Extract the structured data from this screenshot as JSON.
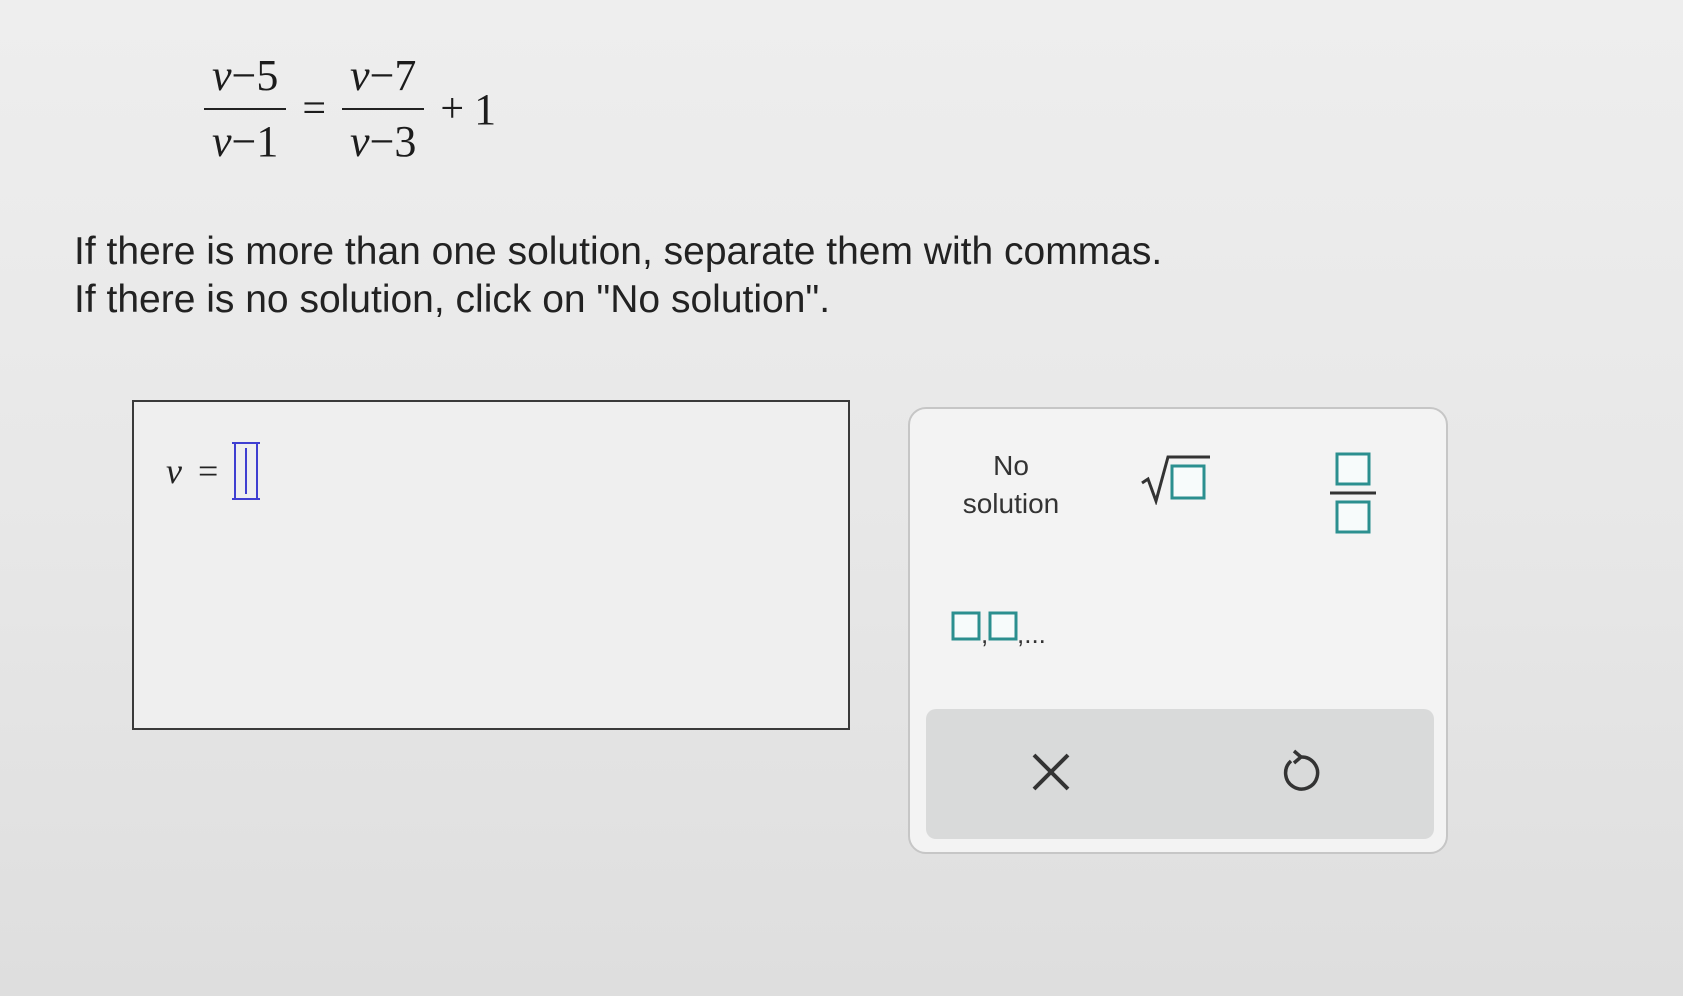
{
  "equation": {
    "left_num_var": "v",
    "left_num_rest": "−5",
    "left_den_var": "v",
    "left_den_rest": "−1",
    "equals": "=",
    "right_num_var": "v",
    "right_num_rest": "−7",
    "right_den_var": "v",
    "right_den_rest": "−3",
    "plus": "+",
    "constant": "1"
  },
  "instructions": {
    "line1": "If there is more than one solution, separate them with commas.",
    "line2": "If there is no solution, click on \"No solution\"."
  },
  "answer": {
    "variable": "v",
    "equals": "="
  },
  "keypad": {
    "no_solution_line1": "No",
    "no_solution_line2": "solution",
    "list_suffix": ",...",
    "comma": ","
  },
  "icons": {
    "sqrt": "sqrt-icon",
    "fraction": "fraction-icon",
    "list": "list-icon",
    "clear": "close-icon",
    "undo": "undo-icon"
  },
  "colors": {
    "accent": "#2b8f8f",
    "cursor": "#3f3fd1",
    "text": "#222222"
  }
}
